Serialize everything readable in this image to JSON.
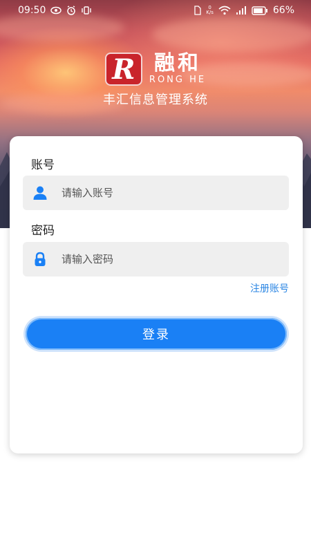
{
  "status_bar": {
    "time": "09:50",
    "net_speed_value": "0",
    "net_speed_unit": "K/s",
    "battery": "66%"
  },
  "brand": {
    "logo_letter": "R",
    "name_cn": "融和",
    "name_en": "RONG HE",
    "system_name": "丰汇信息管理系统"
  },
  "login_form": {
    "account_label": "账号",
    "account_placeholder": "请输入账号",
    "password_label": "密码",
    "password_placeholder": "请输入密码",
    "register_link": "注册账号",
    "login_button": "登录"
  },
  "colors": {
    "accent": "#1a80f5",
    "link": "#2b86e3",
    "icon_blue": "#1a80f5",
    "logo_red": "#c9242b"
  },
  "icons": {
    "account_field": "user-icon",
    "password_field": "lock-icon"
  }
}
